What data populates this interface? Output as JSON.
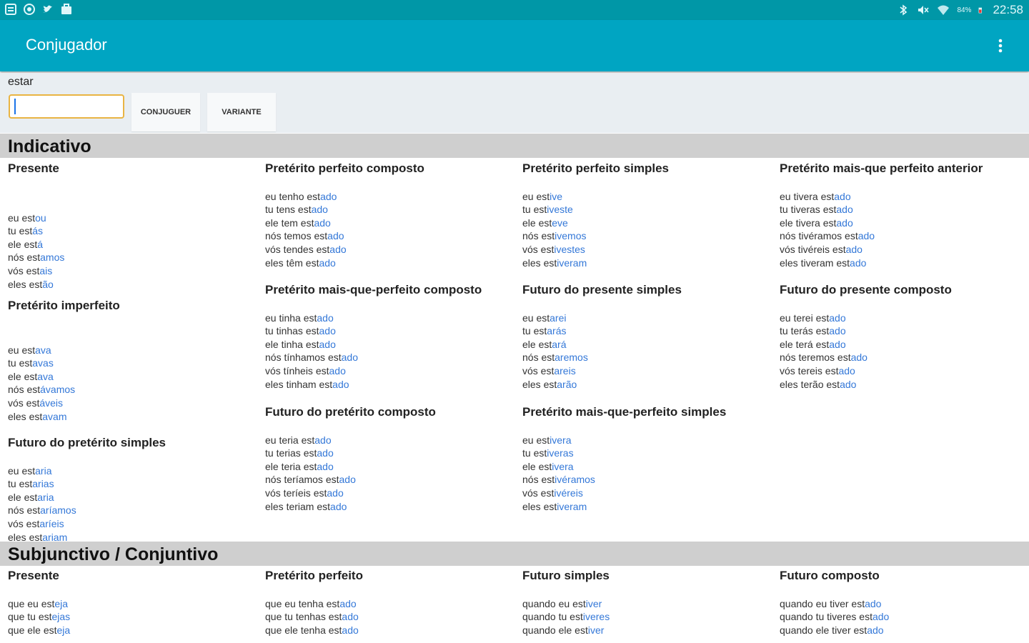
{
  "status_bar": {
    "left_icons": [
      "notification-icon",
      "chrome-icon",
      "twitter-icon",
      "briefcase-icon"
    ],
    "right_icons": [
      "bluetooth-icon",
      "mute-icon",
      "wifi-icon"
    ],
    "battery": "84%",
    "time": "22:58"
  },
  "app_bar": {
    "title": "Conjugador",
    "menu_icon": "more-vert-icon"
  },
  "input": {
    "verb": "estar",
    "value": "",
    "conjugate_label": "CONJUGUER",
    "variant_label": "VARIANTE"
  },
  "colors": {
    "status_bar": "#0097a7",
    "app_bar": "#00a5c2",
    "ending": "#3478d8",
    "section_header": "#cfcfcf",
    "input_border": "#e9b443"
  },
  "sections": [
    {
      "title": "Indicativo",
      "tenses": [
        {
          "title": "Presente",
          "forms": [
            [
              "eu est",
              "ou"
            ],
            [
              "tu est",
              "ás"
            ],
            [
              "ele est",
              "á"
            ],
            [
              "nós est",
              "amos"
            ],
            [
              "vós est",
              "ais"
            ],
            [
              "eles est",
              "ão"
            ]
          ]
        },
        {
          "title": "Pretérito perfeito composto",
          "forms": [
            [
              "eu tenho est",
              "ado"
            ],
            [
              "tu tens est",
              "ado"
            ],
            [
              "ele tem est",
              "ado"
            ],
            [
              "nós temos est",
              "ado"
            ],
            [
              "vós tendes est",
              "ado"
            ],
            [
              "eles têm est",
              "ado"
            ]
          ]
        },
        {
          "title": "Pretérito perfeito simples",
          "forms": [
            [
              "eu est",
              "ive"
            ],
            [
              "tu est",
              "iveste"
            ],
            [
              "ele est",
              "eve"
            ],
            [
              "nós est",
              "ivemos"
            ],
            [
              "vós est",
              "ivestes"
            ],
            [
              "eles est",
              "iveram"
            ]
          ]
        },
        {
          "title": "Pretérito mais-que perfeito anterior",
          "forms": [
            [
              "eu tivera est",
              "ado"
            ],
            [
              "tu tiveras est",
              "ado"
            ],
            [
              "ele tivera est",
              "ado"
            ],
            [
              "nós tivéramos est",
              "ado"
            ],
            [
              "vós tivéreis est",
              "ado"
            ],
            [
              "eles tiveram est",
              "ado"
            ]
          ]
        },
        {
          "title": "Pretérito imperfeito",
          "forms": [
            [
              "eu est",
              "ava"
            ],
            [
              "tu est",
              "avas"
            ],
            [
              "ele est",
              "ava"
            ],
            [
              "nós est",
              "ávamos"
            ],
            [
              "vós est",
              "áveis"
            ],
            [
              "eles est",
              "avam"
            ]
          ]
        },
        {
          "title": "Pretérito mais-que-perfeito composto",
          "forms": [
            [
              "eu tinha est",
              "ado"
            ],
            [
              "tu tinhas est",
              "ado"
            ],
            [
              "ele tinha est",
              "ado"
            ],
            [
              "nós tínhamos est",
              "ado"
            ],
            [
              "vós tínheis est",
              "ado"
            ],
            [
              "eles tinham est",
              "ado"
            ]
          ]
        },
        {
          "title": "Futuro do presente simples",
          "forms": [
            [
              "eu est",
              "arei"
            ],
            [
              "tu est",
              "arás"
            ],
            [
              "ele est",
              "ará"
            ],
            [
              "nós est",
              "aremos"
            ],
            [
              "vós est",
              "areis"
            ],
            [
              "eles est",
              "arão"
            ]
          ]
        },
        {
          "title": "Futuro do presente composto",
          "forms": [
            [
              "eu terei est",
              "ado"
            ],
            [
              "tu terás est",
              "ado"
            ],
            [
              "ele terá est",
              "ado"
            ],
            [
              "nós teremos est",
              "ado"
            ],
            [
              "vós tereis est",
              "ado"
            ],
            [
              "eles terão est",
              "ado"
            ]
          ]
        },
        {
          "title": "Futuro do pretérito simples",
          "forms": [
            [
              "eu est",
              "aria"
            ],
            [
              "tu est",
              "arias"
            ],
            [
              "ele est",
              "aria"
            ],
            [
              "nós est",
              "aríamos"
            ],
            [
              "vós est",
              "aríeis"
            ],
            [
              "eles est",
              "ariam"
            ]
          ]
        },
        {
          "title": "Futuro do pretérito composto",
          "forms": [
            [
              "eu teria est",
              "ado"
            ],
            [
              "tu terias est",
              "ado"
            ],
            [
              "ele teria est",
              "ado"
            ],
            [
              "nós teríamos est",
              "ado"
            ],
            [
              "vós teríeis est",
              "ado"
            ],
            [
              "eles teriam est",
              "ado"
            ]
          ]
        },
        {
          "title": "Pretérito mais-que-perfeito simples",
          "forms": [
            [
              "eu est",
              "ivera"
            ],
            [
              "tu est",
              "iveras"
            ],
            [
              "ele est",
              "ivera"
            ],
            [
              "nós est",
              "ivéramos"
            ],
            [
              "vós est",
              "ivéreis"
            ],
            [
              "eles est",
              "iveram"
            ]
          ]
        }
      ]
    },
    {
      "title": "Subjunctivo / Conjuntivo",
      "tenses": [
        {
          "title": "Presente",
          "forms": [
            [
              "que eu est",
              "eja"
            ],
            [
              "que tu est",
              "ejas"
            ],
            [
              "que ele est",
              "eja"
            ]
          ]
        },
        {
          "title": "Pretérito perfeito",
          "forms": [
            [
              "que eu tenha est",
              "ado"
            ],
            [
              "que tu tenhas est",
              "ado"
            ],
            [
              "que ele tenha est",
              "ado"
            ]
          ]
        },
        {
          "title": "Futuro simples",
          "forms": [
            [
              "quando eu est",
              "iver"
            ],
            [
              "quando tu est",
              "iveres"
            ],
            [
              "quando ele est",
              "iver"
            ]
          ]
        },
        {
          "title": "Futuro composto",
          "forms": [
            [
              "quando eu tiver est",
              "ado"
            ],
            [
              "quando tu tiveres est",
              "ado"
            ],
            [
              "quando ele tiver est",
              "ado"
            ]
          ]
        }
      ]
    }
  ]
}
